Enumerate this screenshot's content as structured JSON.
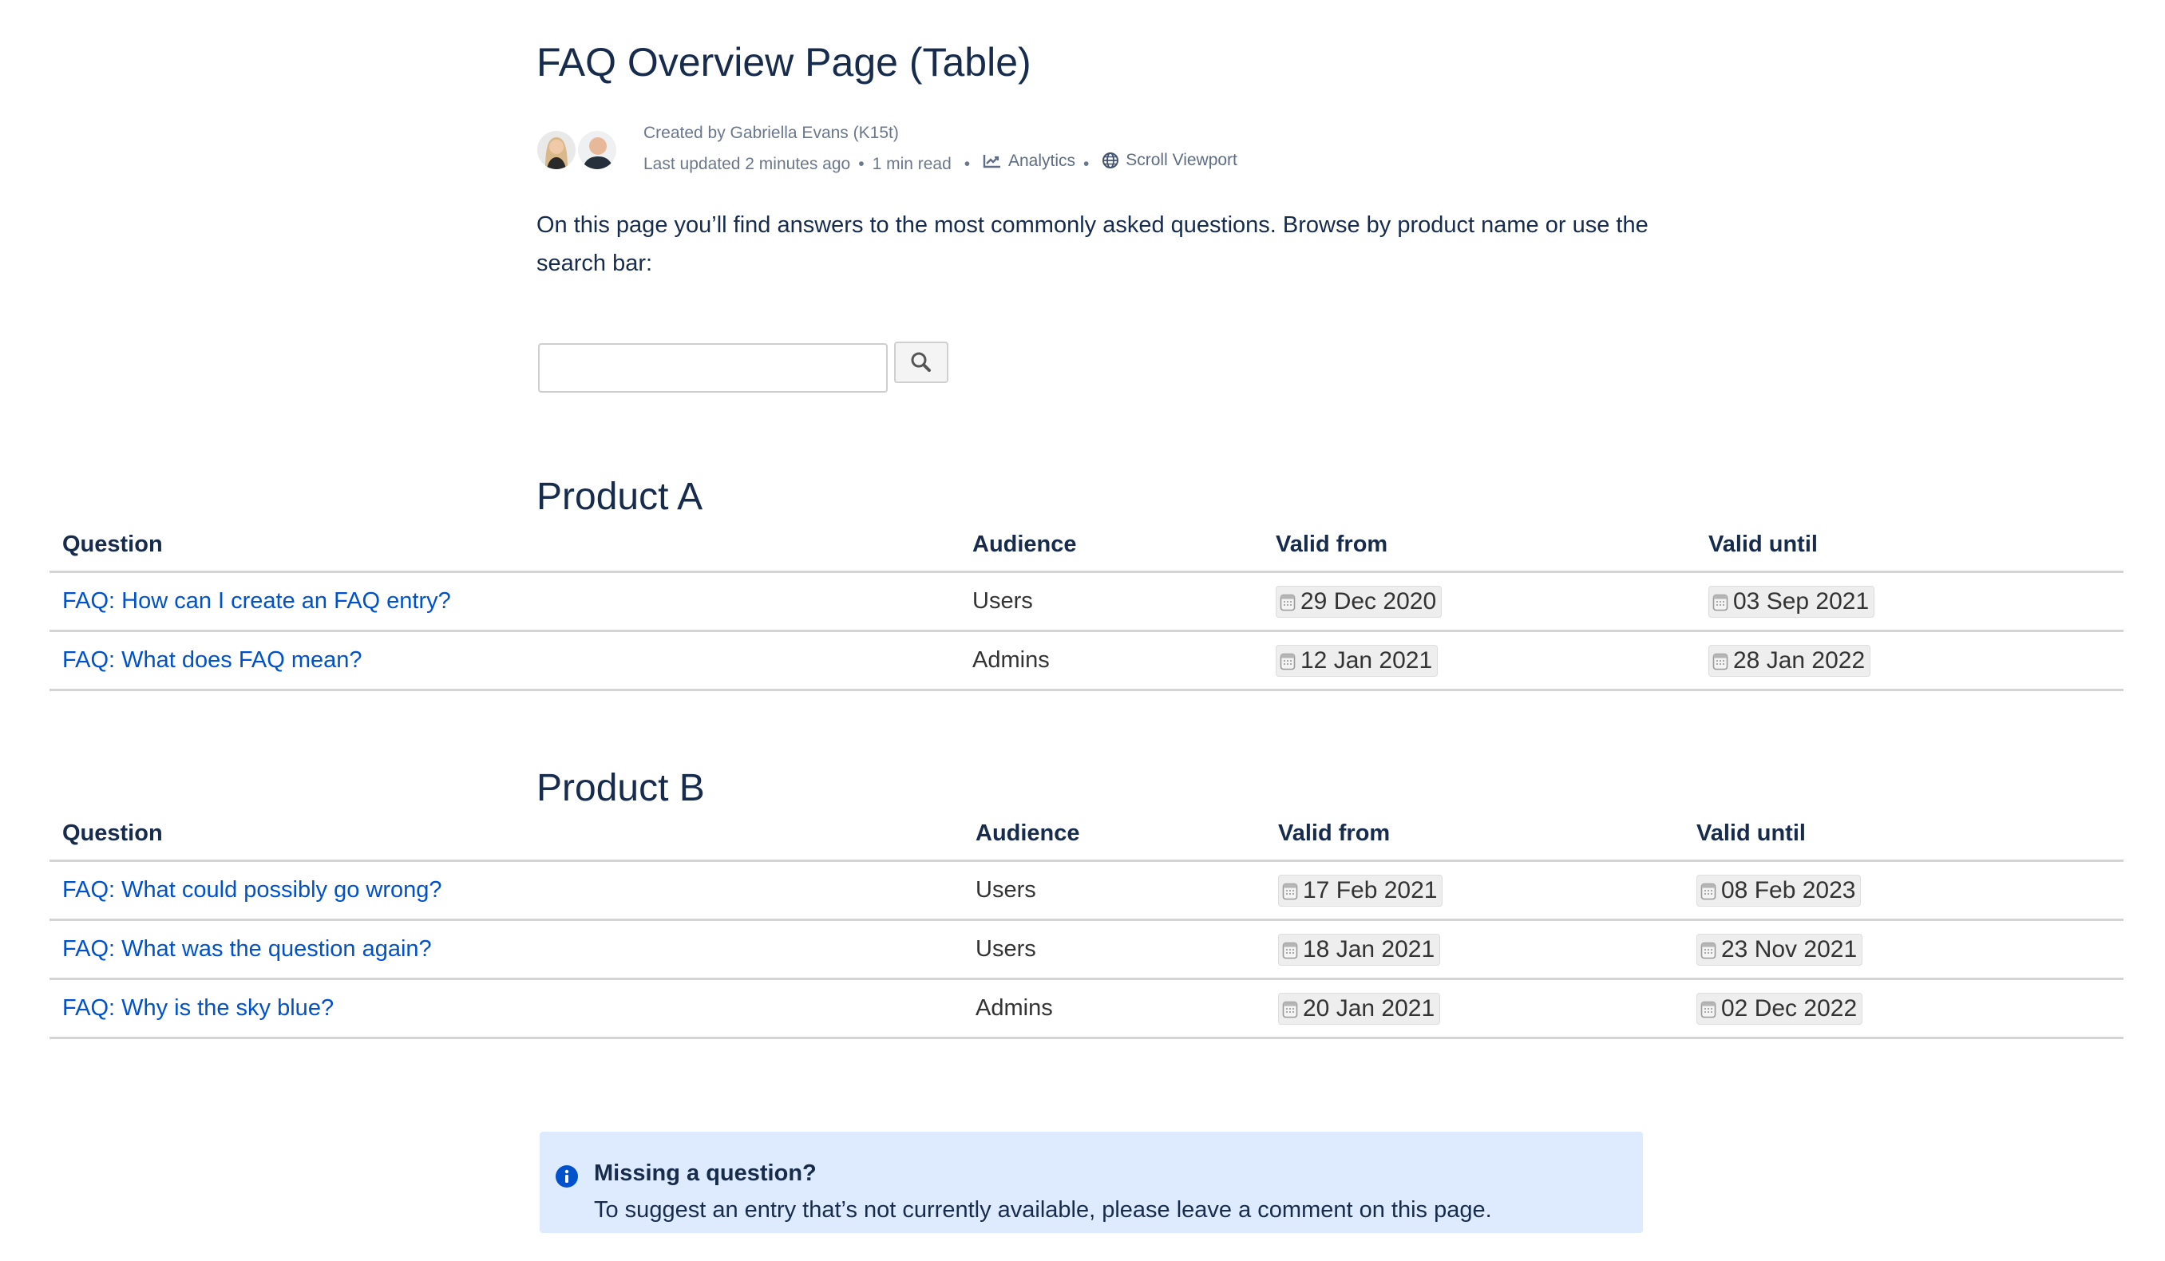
{
  "page": {
    "title": "FAQ Overview Page (Table)"
  },
  "meta": {
    "created_by": "Created by Gabriella Evans (K15t)",
    "last_updated": "Last updated 2 minutes ago",
    "read_time": "1 min read",
    "analytics_label": "Analytics",
    "analytics_icon": "analytics-chart-icon",
    "scroll_viewport_label": "Scroll Viewport",
    "scroll_viewport_icon": "globe-icon",
    "separator": "•",
    "avatars": [
      "Gabriella Evans",
      "Contributor"
    ]
  },
  "intro": {
    "text": "On this page you’ll find answers to the most commonly asked questions. Browse by product name or use the search bar:"
  },
  "search": {
    "value": "",
    "placeholder": "",
    "button_icon": "search-icon"
  },
  "columns": [
    "Question",
    "Audience",
    "Valid from",
    "Valid until"
  ],
  "sections": [
    {
      "heading": "Product A",
      "rows": [
        {
          "question": "FAQ: How can I create an FAQ entry?",
          "audience": "Users",
          "valid_from": "29 Dec 2020",
          "valid_until": "03 Sep 2021"
        },
        {
          "question": "FAQ: What does FAQ mean?",
          "audience": "Admins",
          "valid_from": "12 Jan 2021",
          "valid_until": "28 Jan 2022"
        }
      ]
    },
    {
      "heading": "Product B",
      "rows": [
        {
          "question": "FAQ: What could possibly go wrong?",
          "audience": "Users",
          "valid_from": "17 Feb 2021",
          "valid_until": "08 Feb 2023"
        },
        {
          "question": "FAQ: What was the question again?",
          "audience": "Users",
          "valid_from": "18 Jan 2021",
          "valid_until": "23 Nov 2021"
        },
        {
          "question": "FAQ: Why is the sky blue?",
          "audience": "Admins",
          "valid_from": "20 Jan 2021",
          "valid_until": "02 Dec 2022"
        }
      ]
    }
  ],
  "info_panel": {
    "icon": "info-icon",
    "title": "Missing a question?",
    "body": "To suggest an entry that’s not currently available, please leave a comment on this page."
  },
  "colors": {
    "text": "#172b4d",
    "link": "#0052cc",
    "meta": "#6b778c",
    "info_bg": "#deebff",
    "info_icon": "#0052cc",
    "lozenge_bg": "#eeeeee"
  }
}
